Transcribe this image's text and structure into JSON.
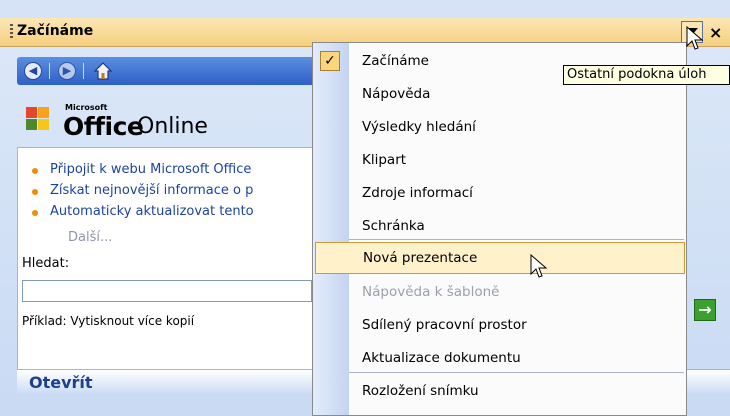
{
  "task_pane": {
    "title": "Začínáme",
    "close_glyph": "×",
    "nav": {
      "back_icon": "back-arrow-icon",
      "forward_icon": "forward-arrow-icon",
      "home_icon": "home-icon"
    },
    "logo": {
      "microsoft": "Microsoft",
      "office": "Office",
      "online": "Online"
    },
    "links": [
      "Připojit k webu Microsoft Office",
      "Získat nejnovější informace o p",
      "Automaticky aktualizovat tento"
    ],
    "more_link": "Další...",
    "search_label": "Hledat:",
    "search_value": "",
    "example": "Příklad: Vytisknout více kopií",
    "go_glyph": "→",
    "open_section": "Otevřít"
  },
  "menu": {
    "items": [
      {
        "label": "Začínáme",
        "checked": true
      },
      {
        "label": "Nápověda"
      },
      {
        "label": "Výsledky hledání"
      },
      {
        "label": "Klipart"
      },
      {
        "label": "Zdroje informací"
      },
      {
        "label": "Schránka"
      },
      {
        "label": "Nová prezentace",
        "highlighted": true
      },
      {
        "label": "Nápověda k šabloně",
        "disabled": true
      },
      {
        "label": "Sdílený pracovní prostor"
      },
      {
        "label": "Aktualizace dokumentu"
      },
      {
        "label": "Rozložení snímku"
      }
    ],
    "check_glyph": "✓"
  },
  "tooltip": "Ostatní podokna úloh",
  "colors": {
    "title_bar": "#f6cf7e",
    "nav_bar": "#2e5fc7",
    "menu_highlight": "#fff1c9",
    "link": "#1d43a0",
    "bullet": "#f18c07"
  }
}
